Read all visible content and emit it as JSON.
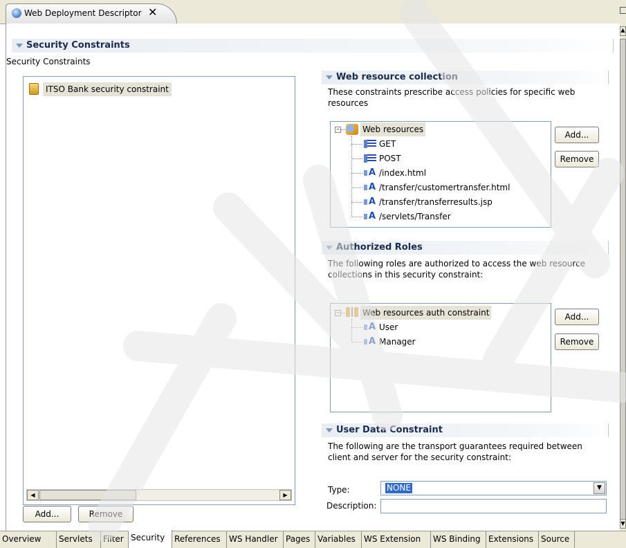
{
  "editor_tab": {
    "title": "Web Deployment Descriptor",
    "close": "✕",
    "icon": "globe-icon"
  },
  "security_constraints": {
    "header": "Security Constraints",
    "description": "Security Constraints",
    "items": [
      {
        "label": "ITSO Bank security constraint",
        "icon": "lock-icon"
      }
    ],
    "add_label": "Add...",
    "remove_label": "Remove"
  },
  "web_resource_collection": {
    "header": "Web resource collection",
    "description_line1": "These constraints prescribe access policies for specific web",
    "description_line2": "resources",
    "root": "Web resources",
    "items": [
      {
        "label": "GET",
        "icon": "http-method-icon"
      },
      {
        "label": "POST",
        "icon": "http-method-icon"
      },
      {
        "label": "/index.html",
        "icon": "url-pattern-icon"
      },
      {
        "label": "/transfer/customertransfer.html",
        "icon": "url-pattern-icon"
      },
      {
        "label": "/transfer/transferresults.jsp",
        "icon": "url-pattern-icon"
      },
      {
        "label": "/servlets/Transfer",
        "icon": "url-pattern-icon"
      }
    ],
    "add_label": "Add...",
    "remove_label": "Remove"
  },
  "authorized_roles": {
    "header": "Authorized Roles",
    "description_line1": "The following roles are authorized to access the web resource",
    "description_line2": "collections in this security constraint:",
    "root": "Web resources auth constraint",
    "items": [
      {
        "label": "User",
        "icon": "role-icon"
      },
      {
        "label": "Manager",
        "icon": "role-icon"
      }
    ],
    "add_label": "Add...",
    "remove_label": "Remove"
  },
  "user_data_constraint": {
    "header": "User Data Constraint",
    "description_line1": "The following are the transport guarantees required between",
    "description_line2": "client and server for the security constraint:",
    "type_label": "Type:",
    "type_value": "NONE",
    "description_label": "Description:",
    "description_value": ""
  },
  "bottom_tabs": [
    {
      "label": "Overview",
      "active": false
    },
    {
      "label": "Servlets",
      "active": false
    },
    {
      "label": "Filter",
      "active": false
    },
    {
      "label": "Security",
      "active": true
    },
    {
      "label": "References",
      "active": false
    },
    {
      "label": "WS Handler",
      "active": false
    },
    {
      "label": "Pages",
      "active": false
    },
    {
      "label": "Variables",
      "active": false
    },
    {
      "label": "WS Extension",
      "active": false
    },
    {
      "label": "WS Binding",
      "active": false
    },
    {
      "label": "Extensions",
      "active": false
    },
    {
      "label": "Source",
      "active": false
    }
  ],
  "colors": {
    "section_header_text": "#1c2a4a",
    "selection": "#316ac5",
    "list_border": "#7f9db9"
  }
}
